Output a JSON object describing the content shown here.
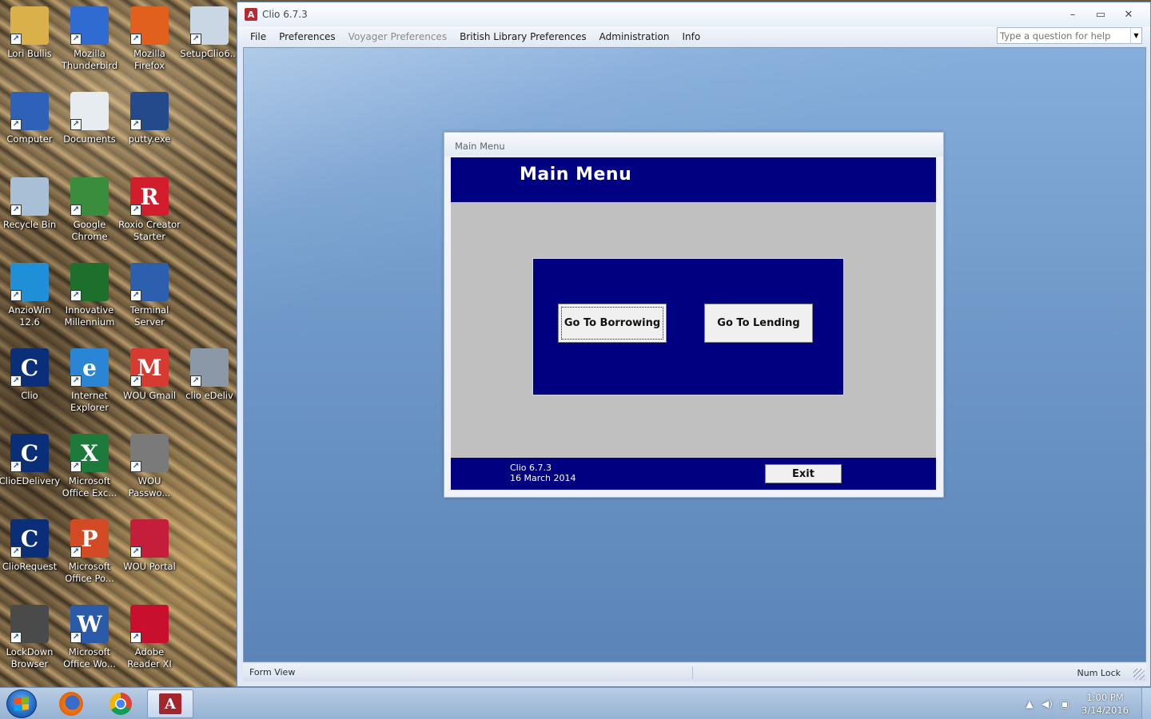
{
  "desktop": {
    "icons": [
      {
        "label": "Lori Bullis",
        "glyph": "",
        "color": "#d9b04a"
      },
      {
        "label": "Mozilla Thunderbird",
        "glyph": "",
        "color": "#2f6bd1"
      },
      {
        "label": "Mozilla Firefox",
        "glyph": "",
        "color": "#e2601d"
      },
      {
        "label": "SetupClio6...",
        "glyph": "",
        "color": "#c9d6e4"
      },
      {
        "label": "Computer",
        "glyph": "",
        "color": "#2d62b8"
      },
      {
        "label": "Documents",
        "glyph": "",
        "color": "#e7ecf1"
      },
      {
        "label": "putty.exe",
        "glyph": "",
        "color": "#244a8c"
      },
      {
        "label": "Recycle Bin",
        "glyph": "",
        "color": "#a8c0d6"
      },
      {
        "label": "Google Chrome",
        "glyph": "",
        "color": "#3b8d3e"
      },
      {
        "label": "Roxio Creator Starter",
        "glyph": "R",
        "color": "#d11d2c"
      },
      {
        "label": "AnzioWin 12.6",
        "glyph": "",
        "color": "#1f8fd8"
      },
      {
        "label": "Innovative Millennium",
        "glyph": "",
        "color": "#1d6f2b"
      },
      {
        "label": "Terminal Server",
        "glyph": "",
        "color": "#2c5fae"
      },
      {
        "label": "Clio",
        "glyph": "C",
        "color": "#0b2e79"
      },
      {
        "label": "Internet Explorer",
        "glyph": "e",
        "color": "#2a86d5"
      },
      {
        "label": "WOU Gmail",
        "glyph": "M",
        "color": "#d63a30"
      },
      {
        "label": "clio eDeliv",
        "glyph": "",
        "color": "#8a98a8"
      },
      {
        "label": "ClioEDelivery",
        "glyph": "C",
        "color": "#0b2e79"
      },
      {
        "label": "Microsoft Office Exc...",
        "glyph": "X",
        "color": "#1d7a3a"
      },
      {
        "label": "WOU Passwo...",
        "glyph": "",
        "color": "#7a7a7a"
      },
      {
        "label": "ClioRequest",
        "glyph": "C",
        "color": "#0b2e79"
      },
      {
        "label": "Microsoft Office Po...",
        "glyph": "P",
        "color": "#d24b25"
      },
      {
        "label": "WOU Portal",
        "glyph": "",
        "color": "#c41e3a"
      },
      {
        "label": "LockDown Browser",
        "glyph": "",
        "color": "#4a4a4a"
      },
      {
        "label": "Microsoft Office Wo...",
        "glyph": "W",
        "color": "#2b5aa8"
      },
      {
        "label": "Adobe Reader XI",
        "glyph": "",
        "color": "#c8102e"
      }
    ]
  },
  "window": {
    "title": "Clio 6.7.3",
    "controls": {
      "minimize": "–",
      "maximize": "▭",
      "close": "✕"
    },
    "menu": [
      {
        "label": "File",
        "enabled": true
      },
      {
        "label": "Preferences",
        "enabled": true
      },
      {
        "label": "Voyager Preferences",
        "enabled": false
      },
      {
        "label": "British Library Preferences",
        "enabled": true
      },
      {
        "label": "Administration",
        "enabled": true
      },
      {
        "label": "Info",
        "enabled": true
      }
    ],
    "help_placeholder": "Type a question for help"
  },
  "form": {
    "caption": "Main Menu",
    "title": "Main Menu",
    "borrow_button": "Go To Borrowing",
    "lend_button": "Go To Lending",
    "version": "Clio 6.7.3",
    "release_date": "16 March 2014",
    "exit_button": "Exit",
    "colors": {
      "header": "#000080",
      "body": "#c0c0c0"
    }
  },
  "statusbar": {
    "view": "Form View",
    "numlock": "Num Lock"
  },
  "taskbar": {
    "apps": [
      {
        "name": "firefox",
        "active": false
      },
      {
        "name": "chrome",
        "active": false
      },
      {
        "name": "access",
        "active": true
      }
    ],
    "clock_time": "1:00 PM",
    "clock_date": "3/14/2016"
  }
}
